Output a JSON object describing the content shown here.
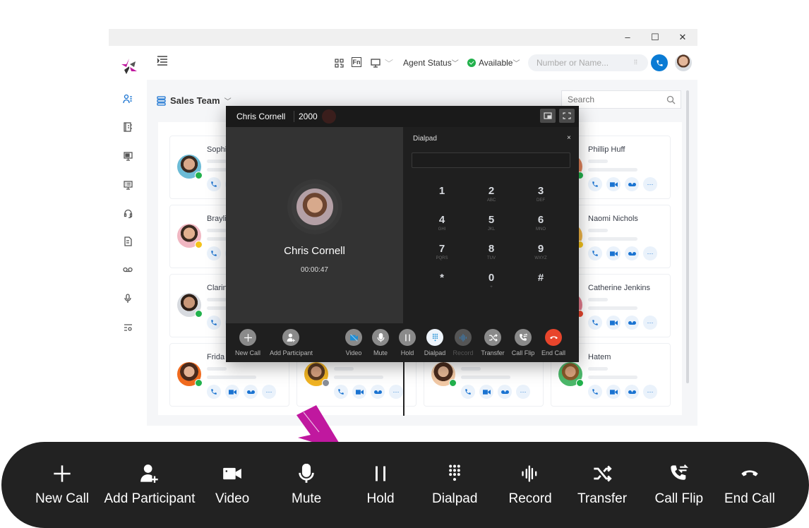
{
  "window": {
    "controls": {
      "minimize": "–",
      "maximize": "☐",
      "close": "✕"
    }
  },
  "sidebar": {
    "items": [
      {
        "name": "contacts",
        "icon": "contacts-icon",
        "active": true
      },
      {
        "name": "directory",
        "icon": "address-book-icon"
      },
      {
        "name": "monitor",
        "icon": "monitor-icon"
      },
      {
        "name": "wallboard",
        "icon": "screen-list-icon"
      },
      {
        "name": "support",
        "icon": "headset-icon"
      },
      {
        "name": "reports",
        "icon": "document-icon"
      },
      {
        "name": "voicemail",
        "icon": "voicemail-icon"
      },
      {
        "name": "recordings",
        "icon": "microphone-icon"
      },
      {
        "name": "settings",
        "icon": "list-settings-icon"
      }
    ]
  },
  "topbar": {
    "fn_label": "Fn",
    "agent_status_label": "Agent Status",
    "availability_label": "Available",
    "dial_placeholder": "Number or Name...",
    "accent": "#0a7bd4",
    "status_color": "#22b14c"
  },
  "content": {
    "team_label": "Sales Team",
    "search_placeholder": "Search",
    "contacts": [
      {
        "name": "Sophi",
        "status": "available",
        "col": 0,
        "row": 0
      },
      {
        "name": "Brayli",
        "status": "away",
        "col": 0,
        "row": 1
      },
      {
        "name": "Clarin",
        "status": "available",
        "col": 0,
        "row": 2
      },
      {
        "name": "Frida",
        "status": "available",
        "col": 0,
        "row": 3
      },
      {
        "name": "",
        "status": "offline",
        "col": 1,
        "row": 3
      },
      {
        "name": "",
        "status": "available",
        "col": 2,
        "row": 3
      },
      {
        "name": "Phillip Huff",
        "status": "available",
        "col": 3,
        "row": 0
      },
      {
        "name": "Naomi Nichols",
        "status": "away",
        "col": 3,
        "row": 1
      },
      {
        "name": "Catherine Jenkins",
        "status": "busy",
        "col": 3,
        "row": 2
      },
      {
        "name": "Hatem",
        "status": "available",
        "col": 3,
        "row": 3
      }
    ],
    "status_colors": {
      "available": "#22b14c",
      "away": "#f4c21b",
      "busy": "#e8452c",
      "offline": "#8a8f99"
    }
  },
  "call_popup": {
    "caller_name": "Chris Cornell",
    "extension": "2000",
    "timer": "00:00:47",
    "dialpad_title": "Dialpad",
    "dialpad_close": "×",
    "keys": [
      {
        "digit": "1",
        "letters": ""
      },
      {
        "digit": "2",
        "letters": "ABC"
      },
      {
        "digit": "3",
        "letters": "DEF"
      },
      {
        "digit": "4",
        "letters": "GHI"
      },
      {
        "digit": "5",
        "letters": "JKL"
      },
      {
        "digit": "6",
        "letters": "MNO"
      },
      {
        "digit": "7",
        "letters": "PQRS"
      },
      {
        "digit": "8",
        "letters": "TUV"
      },
      {
        "digit": "9",
        "letters": "WXYZ"
      },
      {
        "digit": "*",
        "letters": ""
      },
      {
        "digit": "0",
        "letters": "+"
      },
      {
        "digit": "#",
        "letters": ""
      }
    ],
    "controls": [
      {
        "label": "New Call",
        "icon": "plus-icon"
      },
      {
        "label": "Add Participant",
        "icon": "add-participant-icon"
      },
      {
        "label": "Video",
        "icon": "video-off-icon"
      },
      {
        "label": "Mute",
        "icon": "microphone-icon"
      },
      {
        "label": "Hold",
        "icon": "pause-icon"
      },
      {
        "label": "Dialpad",
        "icon": "dialpad-icon",
        "active": true
      },
      {
        "label": "Record",
        "icon": "record-wave-icon",
        "disabled": true
      },
      {
        "label": "Transfer",
        "icon": "transfer-icon"
      },
      {
        "label": "Call Flip",
        "icon": "call-flip-icon"
      },
      {
        "label": "End Call",
        "icon": "end-call-icon"
      }
    ],
    "end_call_color": "#e8452c"
  },
  "legend_bar": {
    "items": [
      {
        "label": "New Call",
        "icon": "plus-icon"
      },
      {
        "label": "Add Participant",
        "icon": "add-participant-icon"
      },
      {
        "label": "Video",
        "icon": "video-icon"
      },
      {
        "label": "Mute",
        "icon": "microphone-icon"
      },
      {
        "label": "Hold",
        "icon": "pause-icon"
      },
      {
        "label": "Dialpad",
        "icon": "dialpad-icon"
      },
      {
        "label": "Record",
        "icon": "record-wave-icon"
      },
      {
        "label": "Transfer",
        "icon": "transfer-icon"
      },
      {
        "label": "Call Flip",
        "icon": "call-flip-icon"
      },
      {
        "label": "End Call",
        "icon": "end-call-icon"
      }
    ],
    "pointer_color": "#c0189f"
  }
}
